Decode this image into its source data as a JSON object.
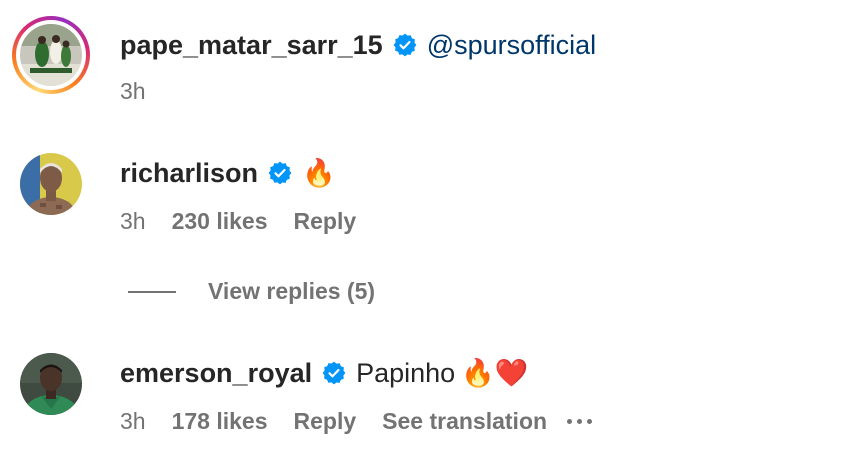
{
  "comments": [
    {
      "username": "pape_matar_sarr_15",
      "verified": true,
      "mention": "@spursofficial",
      "time": "3h",
      "has_story_ring": true
    },
    {
      "username": "richarlison",
      "verified": true,
      "text": "",
      "emoji": "🔥",
      "time": "3h",
      "likes": "230 likes",
      "reply_label": "Reply",
      "view_replies": "View replies (5)"
    },
    {
      "username": "emerson_royal",
      "verified": true,
      "text": "Papinho",
      "emoji": "🔥❤️",
      "time": "3h",
      "likes": "178 likes",
      "reply_label": "Reply",
      "translation_label": "See translation",
      "more_icon": "more-options-icon"
    }
  ],
  "colors": {
    "verified_blue": "#0095f6",
    "mention_blue": "#00376b",
    "secondary_text": "#737373",
    "primary_text": "#262626"
  }
}
